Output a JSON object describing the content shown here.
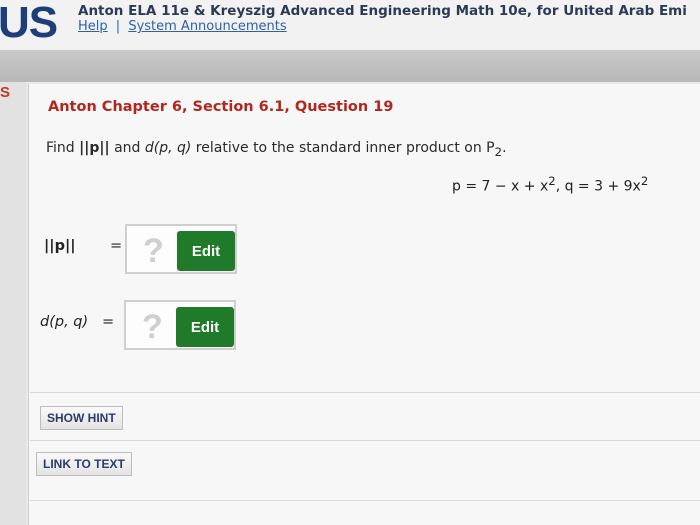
{
  "header": {
    "logo": "US",
    "course_title": "Anton ELA 11e & Kreyszig Advanced Engineering Math 10e, for United Arab Emi",
    "links": [
      "Help",
      "System Announcements"
    ],
    "link_separator": "|"
  },
  "sidebar": {
    "letter": "S"
  },
  "question": {
    "title": "Anton Chapter 6, Section 6.1, Question 19",
    "prompt": {
      "text1": "Find ",
      "norm": "||p||",
      "text2": " and ",
      "dist": "d(p, q)",
      "text3": " relative to the standard inner product on P",
      "sub": "2",
      "text4": "."
    },
    "equation": {
      "p_part": "p = 7 − x + x",
      "exp1": "2",
      "q_part": ", q = 3 + 9x",
      "exp2": "2"
    }
  },
  "answers": [
    {
      "label": "||p||",
      "equals": "=",
      "placeholder": "?",
      "button": "Edit"
    },
    {
      "label": "d(p, q)",
      "equals": "=",
      "placeholder": "?",
      "button": "Edit"
    }
  ],
  "buttons": {
    "show_hint": "SHOW HINT",
    "link_to_text": "LINK TO TEXT"
  }
}
